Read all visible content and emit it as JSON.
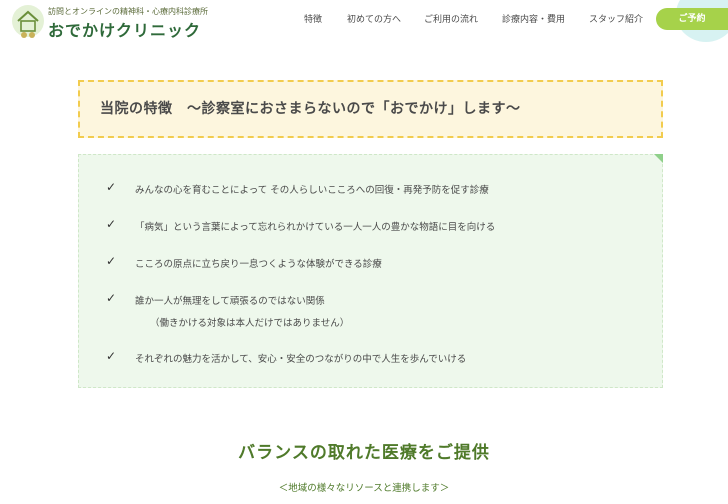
{
  "header": {
    "logo_subtitle": "訪問とオンラインの精神科・心療内科診療所",
    "logo_title": "おでかけクリニック",
    "nav": [
      {
        "label": "特徴"
      },
      {
        "label": "初めての方へ"
      },
      {
        "label": "ご利用の流れ"
      },
      {
        "label": "診療内容・費用"
      },
      {
        "label": "スタッフ紹介"
      }
    ],
    "reserve_label": "ご予約"
  },
  "features": {
    "title": "当院の特徴　～診察室におさまらないので「おでかけ」します～",
    "items": [
      {
        "text": "みんなの心を育むことによって その人らしいこころへの回復・再発予防を促す診療",
        "sub": ""
      },
      {
        "text": "「病気」という言葉によって忘れられかけている一人一人の豊かな物語に目を向ける",
        "sub": ""
      },
      {
        "text": "こころの原点に立ち戻り一息つくような体験ができる診療",
        "sub": ""
      },
      {
        "text": "誰か一人が無理をして頑張るのではない関係",
        "sub": "（働きかける対象は本人だけではありません）"
      },
      {
        "text": "それぞれの魅力を活かして、安心・安全のつながりの中で人生を歩んでいける",
        "sub": ""
      }
    ],
    "check_glyph": "✓"
  },
  "balance": {
    "title": "バランスの取れた医療をご提供",
    "subtitle": "＜地域の様々なリソースと連携します＞"
  },
  "colors": {
    "accent_green": "#a6d24a",
    "title_green": "#4f7a2a",
    "heading_bg": "#fdf6de",
    "heading_border": "#f2cc4e",
    "list_bg": "#eef8ec"
  }
}
